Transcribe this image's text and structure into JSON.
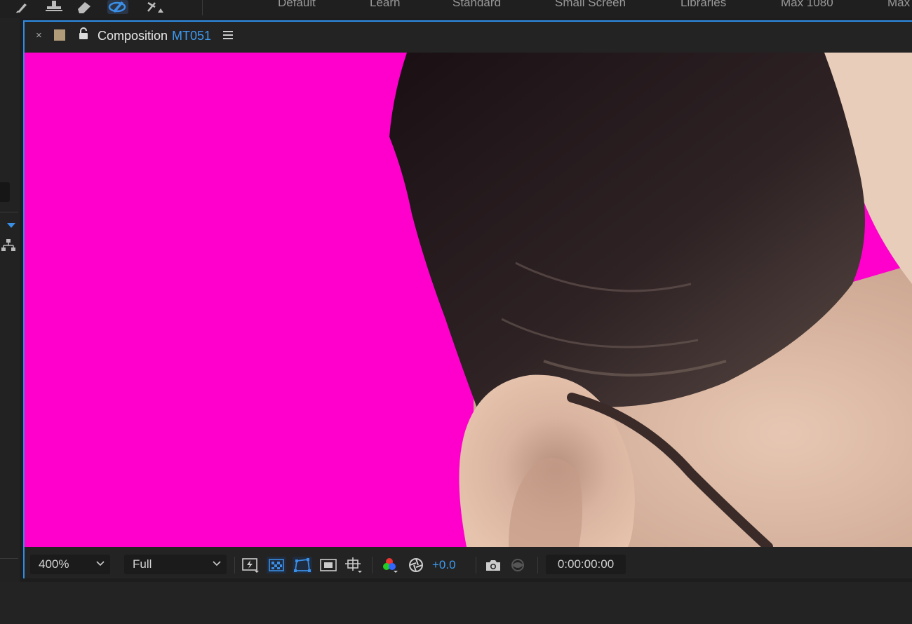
{
  "toolbar": {
    "tools": [
      {
        "name": "brush-tool-icon"
      },
      {
        "name": "clone-stamp-tool-icon"
      },
      {
        "name": "eraser-tool-icon"
      },
      {
        "name": "roto-brush-tool-icon",
        "active": true
      },
      {
        "name": "puppet-pin-tool-icon"
      }
    ],
    "workspaces": [
      "Default",
      "Learn",
      "Standard",
      "Small Screen",
      "Libraries",
      "Max 1080",
      "Max"
    ]
  },
  "panel": {
    "close_label": "×",
    "title": "Composition",
    "comp_name": "MT051",
    "swatch_color": "#b19c7a",
    "accent_color": "#2d8ce6"
  },
  "bottom_bar": {
    "zoom": "400%",
    "resolution": "Full",
    "exposure": "+0.0",
    "timecode": "0:00:00:00"
  },
  "viewer": {
    "background_color": "#ff00cc"
  }
}
